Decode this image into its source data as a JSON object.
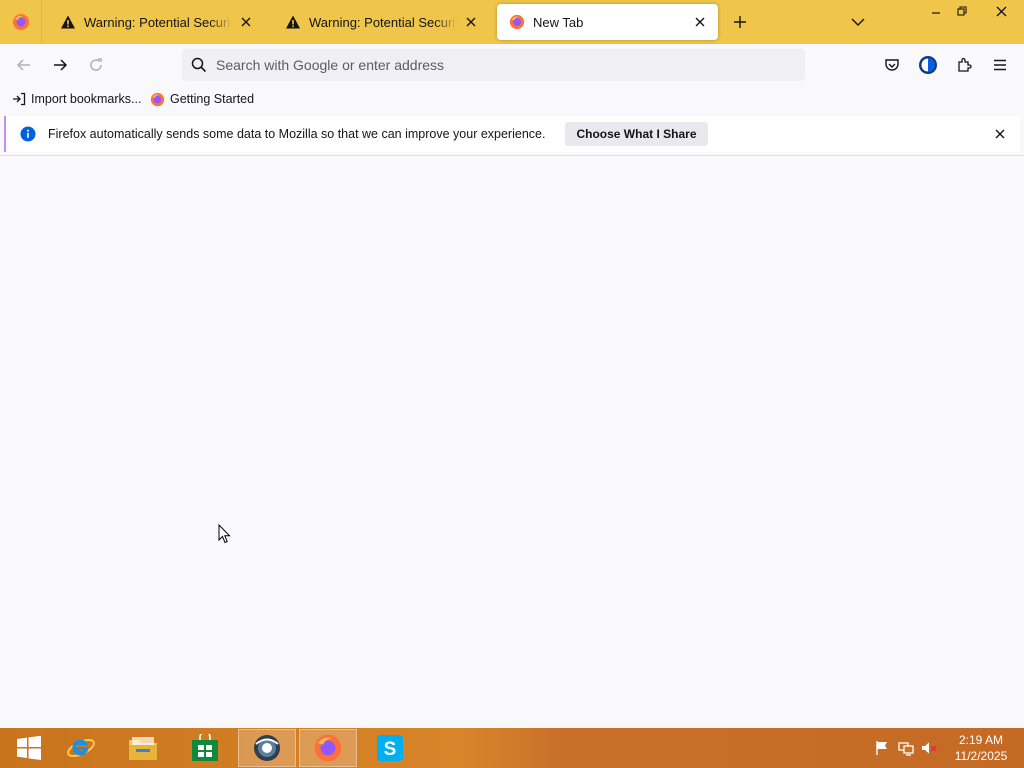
{
  "tabs": [
    {
      "title": "Warning: Potential Security Risk Ahead",
      "active": false,
      "icon": "warning-icon"
    },
    {
      "title": "Warning: Potential Security Risk Ahead",
      "active": false,
      "icon": "warning-icon"
    },
    {
      "title": "New Tab",
      "active": true,
      "icon": "firefox-icon"
    }
  ],
  "urlbar": {
    "placeholder": "Search with Google or enter address",
    "value": ""
  },
  "bookmarks": [
    {
      "label": "Import bookmarks...",
      "icon": "import-icon"
    },
    {
      "label": "Getting Started",
      "icon": "firefox-icon"
    }
  ],
  "notification": {
    "text": "Firefox automatically sends some data to Mozilla so that we can improve your experience.",
    "button_label": "Choose What I Share",
    "icon": "info-icon"
  },
  "taskbar": {
    "apps": [
      "start-icon",
      "internet-explorer-icon",
      "file-explorer-icon",
      "store-icon",
      "settings-app-icon",
      "firefox-icon",
      "skype-icon"
    ],
    "time": "2:19 AM",
    "date": "11/2/2025"
  },
  "colors": {
    "tabstrip": "#f0c64a",
    "accent": "#0060df",
    "notification_border": "#c78cf7",
    "taskbar": "#d8852a"
  }
}
